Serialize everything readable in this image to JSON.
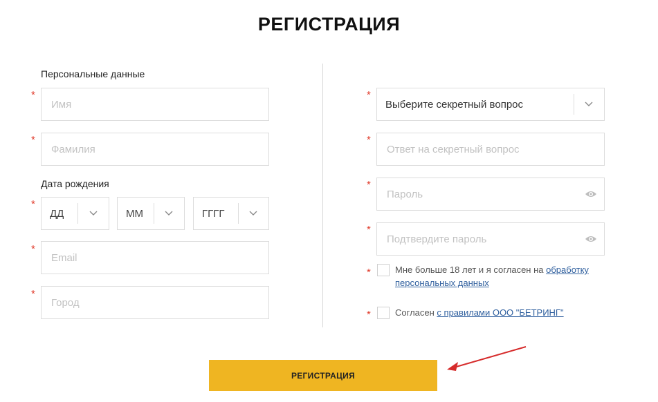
{
  "page": {
    "title": "РЕГИСТРАЦИЯ"
  },
  "left": {
    "personal_label": "Персональные данные",
    "name_placeholder": "Имя",
    "surname_placeholder": "Фамилия",
    "birth_label": "Дата рождения",
    "day_value": "ДД",
    "month_value": "ММ",
    "year_value": "ГГГГ",
    "email_placeholder": "Email",
    "city_placeholder": "Город"
  },
  "right": {
    "secret_question_value": "Выберите секретный вопрос",
    "secret_answer_placeholder": "Ответ на секретный вопрос",
    "password_placeholder": "Пароль",
    "confirm_password_placeholder": "Подтвердите пароль",
    "age_consent_text": "Мне больше 18 лет и я согласен на ",
    "age_consent_link": "обработку персональных данных",
    "rules_consent_text": "Согласен ",
    "rules_consent_link": "с правилами ООО \"БЕТРИНГ\""
  },
  "required_marker": "*",
  "submit_label": "РЕГИСТРАЦИЯ",
  "colors": {
    "accent_button": "#efb522",
    "required": "#e03a2a",
    "link": "#2f5f9e",
    "arrow": "#d62b2b"
  },
  "icons": {
    "dropdown": "chevron-down-icon",
    "password_toggle": "eye-icon",
    "annotation": "red-arrow-icon"
  }
}
